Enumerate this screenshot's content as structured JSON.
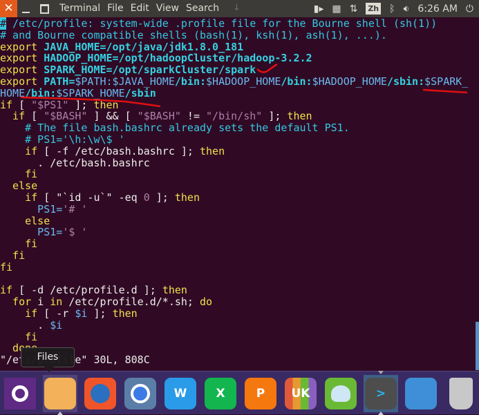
{
  "topbar": {
    "close_icon": "close-icon",
    "menu": [
      "Terminal",
      "File",
      "Edit",
      "View",
      "Search"
    ],
    "clock": "6:26 AM",
    "input_method": "Zh",
    "indicators": [
      "indicator-icon",
      "calendar-icon",
      "network-icon",
      "input-method-icon",
      "bluetooth-icon",
      "volume-icon",
      "power-icon"
    ]
  },
  "colors": {
    "background": "#300a24",
    "comment": "#34c9e2",
    "keyword": "#f2e04e",
    "variable": "#34d2e2",
    "reference": "#6bb9f0",
    "string": "#ad7fa8",
    "annotation": "#e01010"
  },
  "terminal": {
    "lines": [
      [
        [
          "#",
          "cursor"
        ],
        [
          " /etc/profile: system-wide .profile file for the Bourne shell (sh(1))",
          "comment"
        ]
      ],
      [
        [
          "# and Bourne compatible shells (bash(1), ksh(1), ash(1), ...).",
          "comment"
        ]
      ],
      [
        [
          "export",
          "kw"
        ],
        [
          " JAVA_HOME=/opt/java/jdk1.8.0_181",
          "var"
        ]
      ],
      [
        [
          "export",
          "kw"
        ],
        [
          " HADOOP_HOME=/opt/hadoopCluster/hadoop-3.2.2",
          "var"
        ]
      ],
      [
        [
          "export",
          "kw"
        ],
        [
          " SPARK_HOME=/opt/sparkCluster/spark",
          "var"
        ]
      ],
      [
        [
          "export",
          "kw"
        ],
        [
          " PATH=",
          "var"
        ],
        [
          "$PATH:$JAVA_HOME",
          "ref"
        ],
        [
          "/bin:",
          "var"
        ],
        [
          "$HADOOP_HOME",
          "ref"
        ],
        [
          "/bin:",
          "var"
        ],
        [
          "$HADOOP_HOME",
          "ref"
        ],
        [
          "/sbin:",
          "var"
        ],
        [
          "$SPARK_",
          "ref"
        ]
      ],
      [
        [
          "HOME",
          "ref"
        ],
        [
          "/bin:",
          "var"
        ],
        [
          "$SPARK_HOME",
          "ref"
        ],
        [
          "/sbin",
          "var"
        ]
      ],
      [
        [
          "if",
          "kw"
        ],
        [
          " [ ",
          "txt"
        ],
        [
          "\"$PS1\"",
          "str"
        ],
        [
          " ]; ",
          "txt"
        ],
        [
          "then",
          "kw"
        ]
      ],
      [
        [
          "  if",
          "kw"
        ],
        [
          " [ ",
          "txt"
        ],
        [
          "\"$BASH\"",
          "str"
        ],
        [
          " ] && [ ",
          "txt"
        ],
        [
          "\"$BASH\"",
          "str"
        ],
        [
          " != ",
          "txt"
        ],
        [
          "\"/bin/sh\"",
          "str"
        ],
        [
          " ]; ",
          "txt"
        ],
        [
          "then",
          "kw"
        ]
      ],
      [
        [
          "    # The file bash.bashrc already sets the default PS1.",
          "comment"
        ]
      ],
      [
        [
          "    # PS1='\\h:\\w\\$ '",
          "comment"
        ]
      ],
      [
        [
          "    if",
          "kw"
        ],
        [
          " [ -f /etc/bash.bashrc ]; ",
          "txt"
        ],
        [
          "then",
          "kw"
        ]
      ],
      [
        [
          "      . /etc/bash.bashrc",
          "txt"
        ]
      ],
      [
        [
          "    fi",
          "kw"
        ]
      ],
      [
        [
          "  else",
          "kw"
        ]
      ],
      [
        [
          "    if",
          "kw"
        ],
        [
          " [ ",
          "txt"
        ],
        [
          "\"`id -u`\"",
          "txt"
        ],
        [
          " -eq ",
          "txt"
        ],
        [
          "0",
          "num"
        ],
        [
          " ]; ",
          "txt"
        ],
        [
          "then",
          "kw"
        ]
      ],
      [
        [
          "      PS1=",
          "ref"
        ],
        [
          "'# '",
          "str"
        ]
      ],
      [
        [
          "    else",
          "kw"
        ]
      ],
      [
        [
          "      PS1=",
          "ref"
        ],
        [
          "'$ '",
          "str"
        ]
      ],
      [
        [
          "    fi",
          "kw"
        ]
      ],
      [
        [
          "  fi",
          "kw"
        ]
      ],
      [
        [
          "fi",
          "kw"
        ]
      ],
      [
        [
          "",
          "txt"
        ]
      ],
      [
        [
          "if",
          "kw"
        ],
        [
          " [ -d /etc/profile.d ]; ",
          "txt"
        ],
        [
          "then",
          "kw"
        ]
      ],
      [
        [
          "  for",
          "kw"
        ],
        [
          " i ",
          "txt"
        ],
        [
          "in",
          "kw"
        ],
        [
          " /etc/profile.d/*.sh; ",
          "txt"
        ],
        [
          "do",
          "kw"
        ]
      ],
      [
        [
          "    if",
          "kw"
        ],
        [
          " [ -r ",
          "txt"
        ],
        [
          "$i",
          "ref"
        ],
        [
          " ]; ",
          "txt"
        ],
        [
          "then",
          "kw"
        ]
      ],
      [
        [
          "      . ",
          "txt"
        ],
        [
          "$i",
          "ref"
        ]
      ],
      [
        [
          "    fi",
          "kw"
        ]
      ],
      [
        [
          "  done",
          "kw"
        ]
      ],
      [
        [
          "\"/etc/profile\" 30L, 808C",
          "txt"
        ]
      ]
    ]
  },
  "tooltip": {
    "text": "Files"
  },
  "dock": {
    "items": [
      {
        "name": "ubuntu-dash",
        "icon": "ubuntu-logo-icon",
        "color": "#5e2a83"
      },
      {
        "name": "files",
        "icon": "folder-icon",
        "color": "#f3b25a",
        "glyph": ""
      },
      {
        "name": "firefox",
        "icon": "firefox-icon",
        "color": "#f0552a"
      },
      {
        "name": "chromium",
        "icon": "chromium-icon",
        "color": "#5b7ea8"
      },
      {
        "name": "word",
        "icon": "word-icon",
        "color": "#2a9be8",
        "glyph": "W"
      },
      {
        "name": "excel",
        "icon": "excel-icon",
        "color": "#12b54e",
        "glyph": "X"
      },
      {
        "name": "powerpoint",
        "icon": "powerpoint-icon",
        "color": "#f5780f",
        "glyph": "P"
      },
      {
        "name": "ubuntu-software",
        "icon": "software-center-icon",
        "color": "#e9e9e9",
        "glyph": "UK"
      },
      {
        "name": "software-updater",
        "icon": "updater-icon",
        "color": "#6ab934"
      },
      {
        "name": "terminal",
        "icon": "terminal-icon",
        "color": "#4d4d4d",
        "glyph": ">"
      },
      {
        "name": "workspaces",
        "icon": "workspace-switcher-icon",
        "color": "#3f8fd8"
      },
      {
        "name": "trash",
        "icon": "trash-icon",
        "color": "#c8c8c8"
      }
    ]
  }
}
